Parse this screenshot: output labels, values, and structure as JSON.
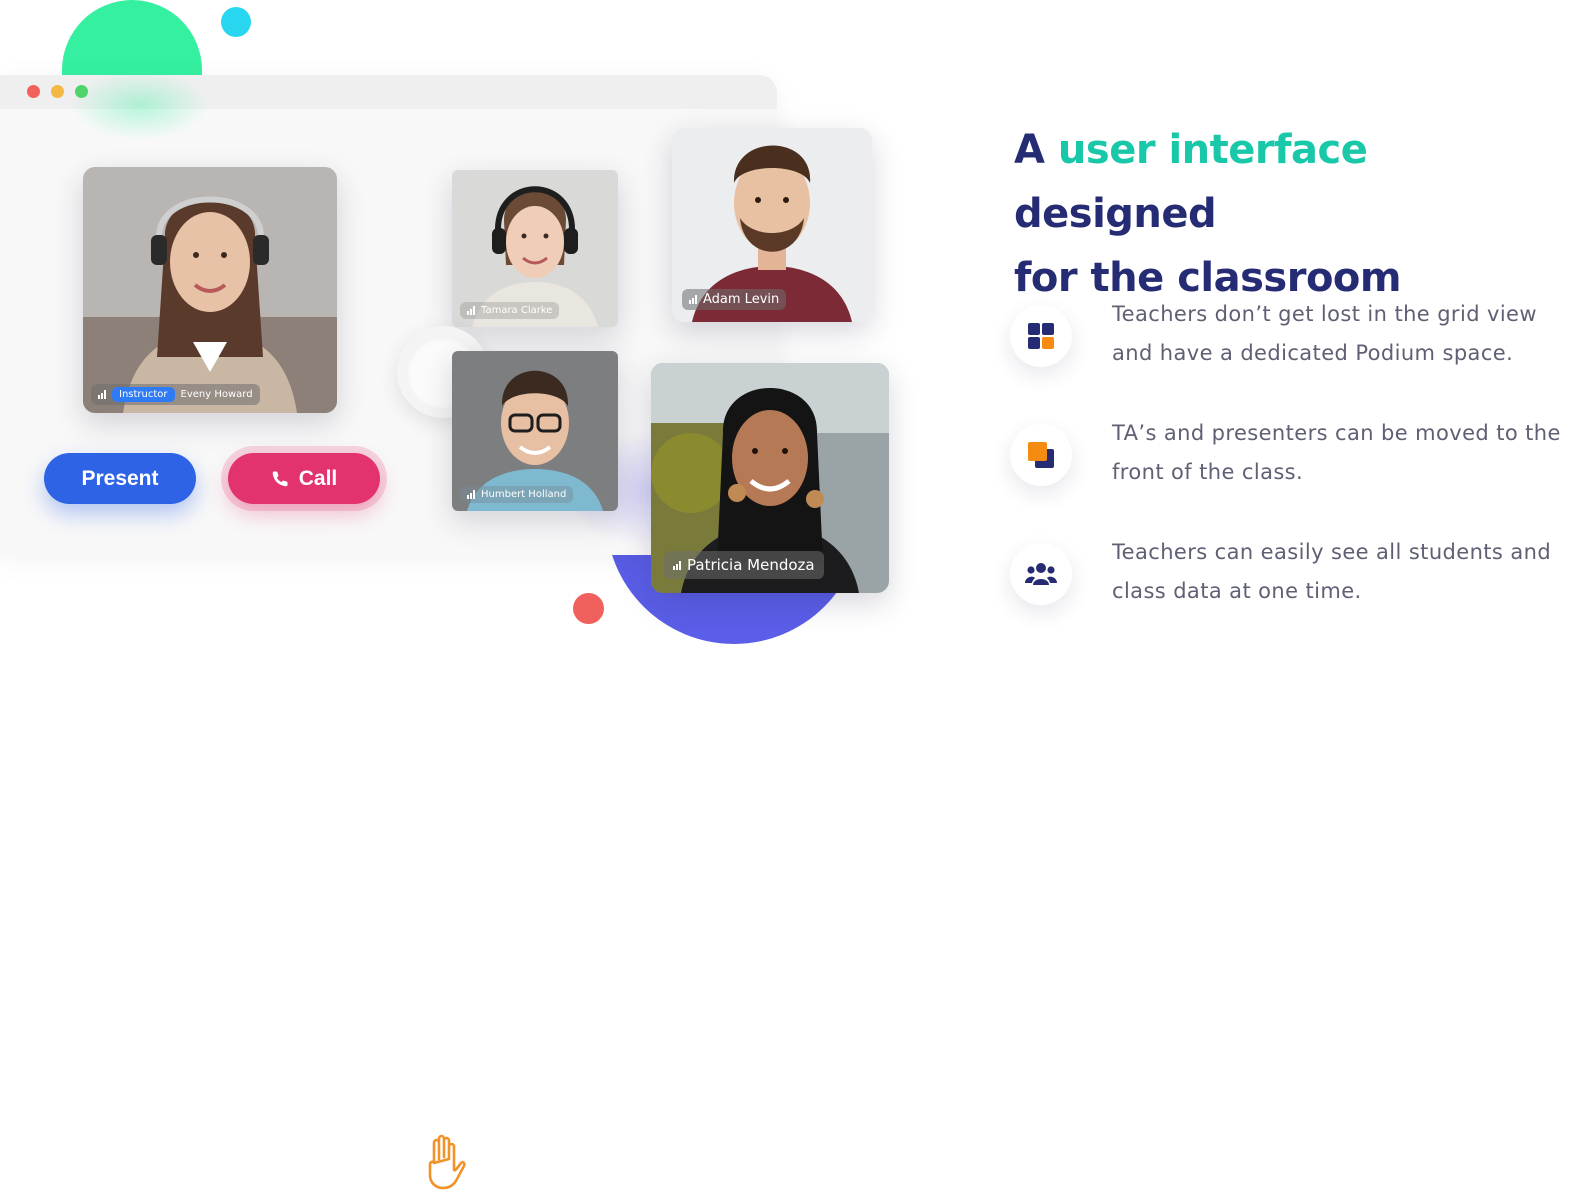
{
  "heading": {
    "prefix": "A",
    "accent": "user interface",
    "rest_line1": "designed",
    "line2": "for the classroom"
  },
  "features": [
    {
      "icon": "grid-icon",
      "text": "Teachers don’t get lost in the grid view and have a dedicated Podium space."
    },
    {
      "icon": "stacked-squares-icon",
      "text": "TA’s and presenters can be moved to the front of the class."
    },
    {
      "icon": "users-group-icon",
      "text": "Teachers can easily see all students and class data at one time."
    }
  ],
  "participants": {
    "instructor": {
      "role_badge": "Instructor",
      "name": "Eveny Howard"
    },
    "tamara": {
      "name": "Tamara Clarke"
    },
    "adam": {
      "name": "Adam Levin"
    },
    "humbert": {
      "name": "Humbert Holland"
    },
    "patricia": {
      "name": "Patricia Mendoza"
    }
  },
  "buttons": {
    "present": "Present",
    "call": "Call"
  },
  "colors": {
    "heading": "#262c74",
    "accent": "#19c8a8",
    "present_button": "#2f63e6",
    "call_button": "#e2336f",
    "body_text": "#5f6074"
  }
}
